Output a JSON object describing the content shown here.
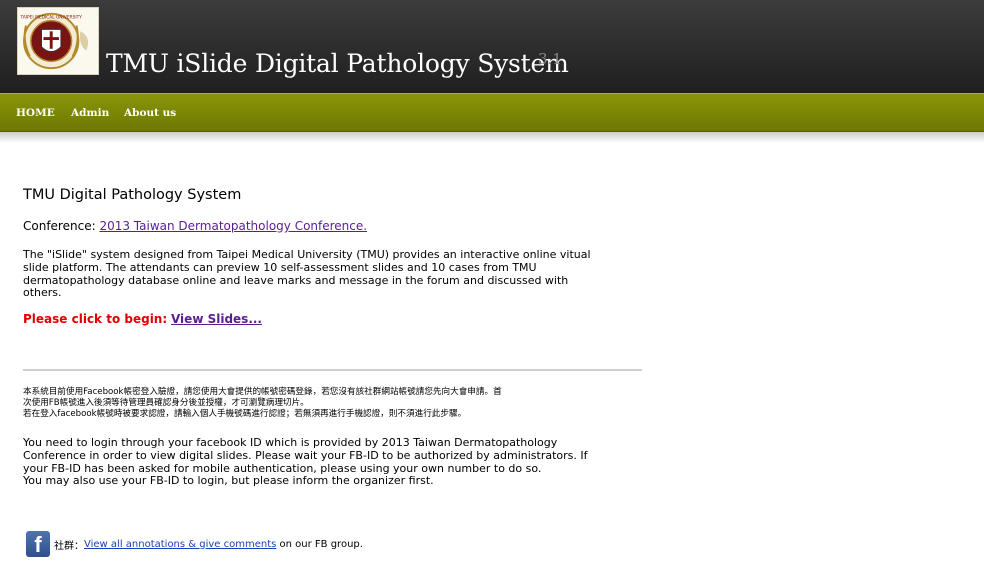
{
  "header": {
    "logo_text": "TAIPEI MEDICAL UNIVERSITY",
    "title": "TMU iSlide Digital Pathology System",
    "version": "3.1"
  },
  "nav": {
    "items": [
      {
        "label": "HOME"
      },
      {
        "label": "Admin"
      },
      {
        "label": "About us"
      }
    ]
  },
  "content": {
    "title": "TMU Digital Pathology System",
    "conference_label": "Conference:",
    "conference_link": "2013 Taiwan Dermatopathology Conference.",
    "description_lines": [
      "The \"iSlide\" system designed from Taipei Medical University (TMU) provides an interactive online vitual",
      "slide platform. The attendants can preview 10 self-assessment slides and 10 cases from TMU",
      "dermatopathology database online and leave marks and message in the forum and discussed with",
      "others."
    ],
    "begin_label": "Please click to begin:",
    "begin_link": "View Slides...",
    "notice_cn_lines": [
      "本系統目前使用Facebook帳密登入驗證，請您使用大會提供的帳號密碼登錄，若您沒有該社群網站帳號請您先向大會申請。首",
      "次使用FB帳號進入後須等待管理員確認身分後並授權，才可瀏覽病理切片。",
      "若在登入facebook帳號時被要求認證，請輸入個人手機號碼進行認證；若無須再進行手機認證，則不須進行此步驟。"
    ],
    "notice_en_lines": [
      "You need to login through your facebook ID which is provided by 2013 Taiwan Dermatopathology",
      "Conference in order to view digital slides. Please wait your FB-ID to be authorized by administrators. If",
      "your FB-ID has been asked for mobile authentication, please using your own number to do so.",
      "You may also use your FB-ID to login, but please inform the organizer first."
    ],
    "fb": {
      "icon": "facebook-icon",
      "icon_glyph": "f",
      "prefix": "社群：",
      "link": "View all annotations & give comments",
      "suffix": " on our FB group."
    }
  },
  "colors": {
    "header_bg": "#2b2b2b",
    "nav_bg": "#7b8605",
    "link": "#5a1f8f",
    "alert": "#e00000"
  }
}
